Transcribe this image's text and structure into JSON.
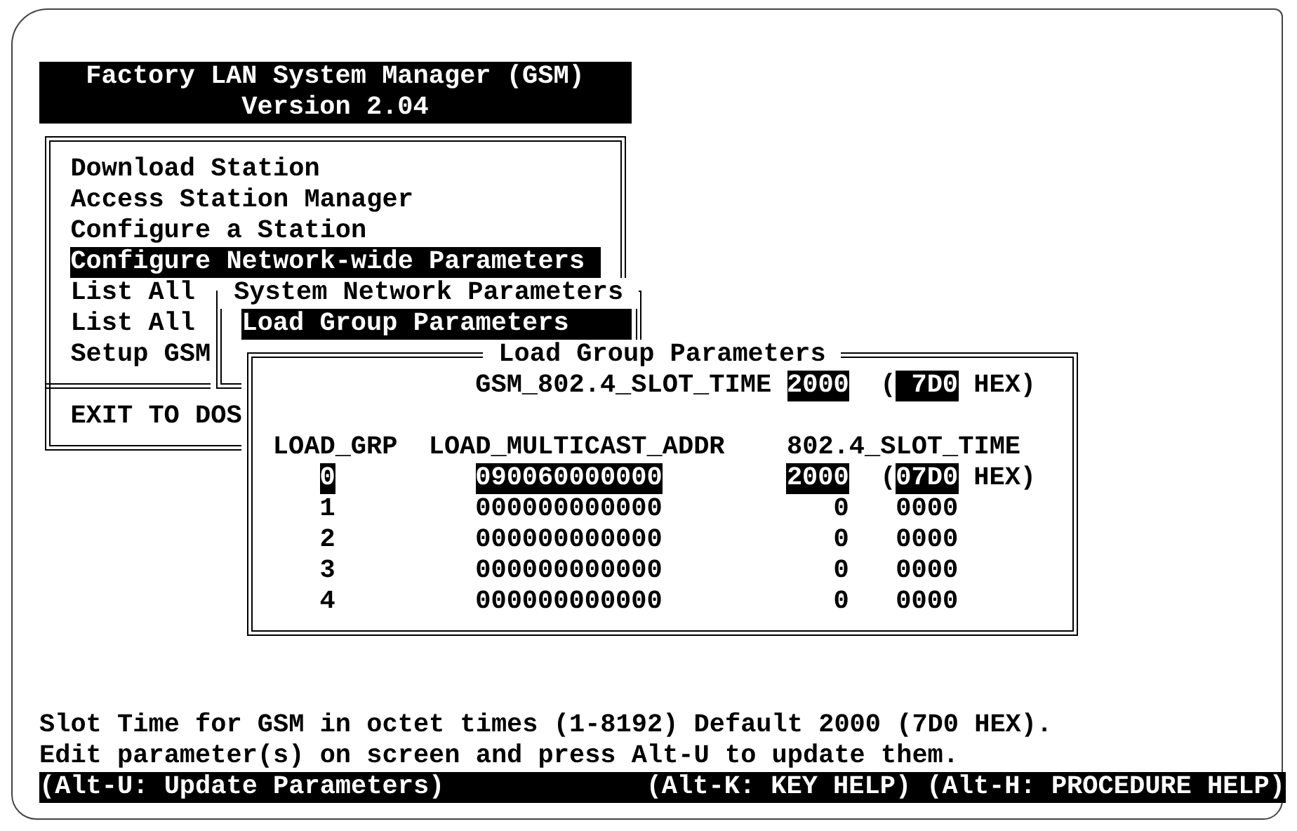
{
  "header": {
    "title": "Factory LAN System Manager (GSM)",
    "version": "Version 2.04"
  },
  "main_menu": {
    "items": [
      {
        "label": "Download Station",
        "selected": false
      },
      {
        "label": "Access Station Manager",
        "selected": false
      },
      {
        "label": "Configure a Station",
        "selected": false
      },
      {
        "label": "Configure Network-wide Parameters",
        "selected": true
      },
      {
        "label": "List All",
        "selected": false
      },
      {
        "label": "List All",
        "selected": false
      },
      {
        "label": "Setup GSM",
        "selected": false
      }
    ],
    "exit": "EXIT TO DOS"
  },
  "system_network_window": {
    "title": "System Network Parameters",
    "items": [
      {
        "label": "Load Group Parameters",
        "selected": true
      }
    ]
  },
  "load_group_window": {
    "title": "Load Group Parameters",
    "slot_time": {
      "label": "GSM_802.4_SLOT_TIME",
      "value": "2000",
      "open": "(",
      "hex": "7D0",
      "close": "HEX)"
    },
    "columns": [
      "LOAD_GRP",
      "LOAD_MULTICAST_ADDR",
      "802.4_SLOT_TIME"
    ],
    "rows": [
      {
        "group": "0",
        "address": "090060000000",
        "slot_time": "2000",
        "open": "(",
        "hex": "07D0",
        "close": "HEX)",
        "selected": true
      },
      {
        "group": "1",
        "address": "000000000000",
        "slot_time": "0",
        "hex": "0000",
        "selected": false
      },
      {
        "group": "2",
        "address": "000000000000",
        "slot_time": "0",
        "hex": "0000",
        "selected": false
      },
      {
        "group": "3",
        "address": "000000000000",
        "slot_time": "0",
        "hex": "0000",
        "selected": false
      },
      {
        "group": "4",
        "address": "000000000000",
        "slot_time": "0",
        "hex": "0000",
        "selected": false
      }
    ]
  },
  "help_lines": [
    "Slot Time for GSM in octet times (1-8192) Default 2000 (7D0 HEX).",
    "Edit parameter(s) on screen and press Alt-U to update them."
  ],
  "status_bar": {
    "left": "(Alt-U: Update Parameters)",
    "right": "(Alt-K: KEY HELP) (Alt-H: PROCEDURE HELP)"
  }
}
